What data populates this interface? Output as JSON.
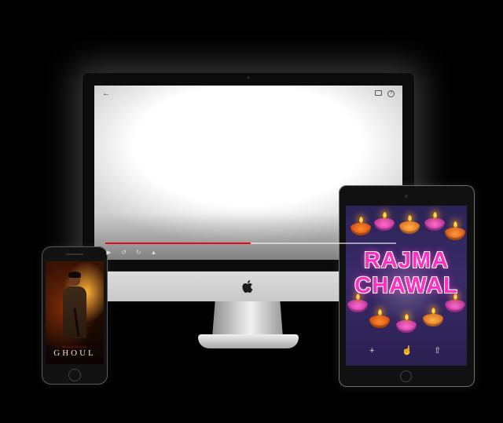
{
  "imac": {
    "player": {
      "icons": {
        "back": "arrow-left-icon",
        "cast": "cast-icon",
        "help": "help-icon"
      },
      "progress_fraction": 0.5,
      "controls": [
        "play-icon",
        "rewind-10-icon",
        "forward-10-icon",
        "volume-icon"
      ]
    },
    "logo": "apple-logo"
  },
  "phone": {
    "tag": "NETFLIX ORIGINAL",
    "title": "GHOUL"
  },
  "tablet": {
    "title_line1": "RAJMA",
    "title_line2": "CHAWAL",
    "actions": [
      "plus-icon",
      "thumbs-up-icon",
      "share-icon"
    ]
  },
  "colors": {
    "background": "#000000",
    "progress": "#e50914",
    "title_pink": "#ff2fc2"
  }
}
